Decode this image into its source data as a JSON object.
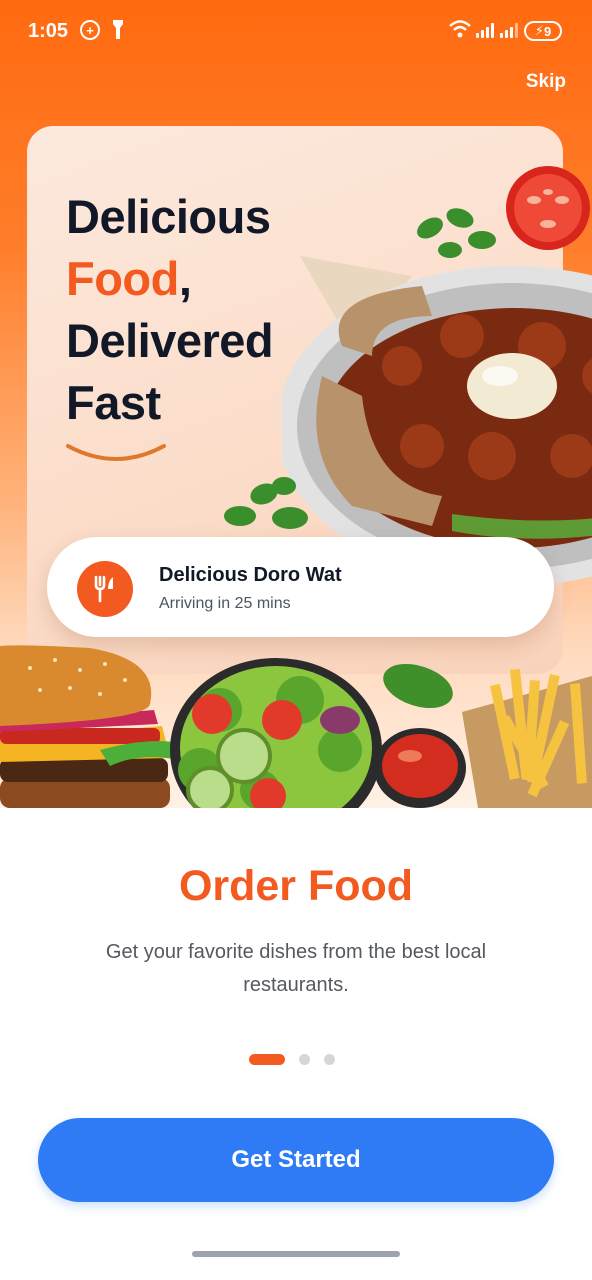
{
  "status_bar": {
    "time": "1:05",
    "battery": "9"
  },
  "header": {
    "skip_label": "Skip"
  },
  "hero": {
    "headline_line1": "Delicious",
    "headline_accent": "Food",
    "headline_comma": ",",
    "headline_line3": "Delivered",
    "headline_line4": "Fast"
  },
  "order_card": {
    "title": "Delicious Doro Wat",
    "subtitle": "Arriving in 25 mins",
    "icon": "fork-knife-icon"
  },
  "onboarding": {
    "title": "Order Food",
    "description": "Get your favorite dishes from the best local restaurants.",
    "page_count": 3,
    "active_page": 1
  },
  "cta": {
    "label": "Get Started"
  },
  "colors": {
    "brand_orange": "#f25a1f",
    "cta_blue": "#2f7bf5"
  }
}
